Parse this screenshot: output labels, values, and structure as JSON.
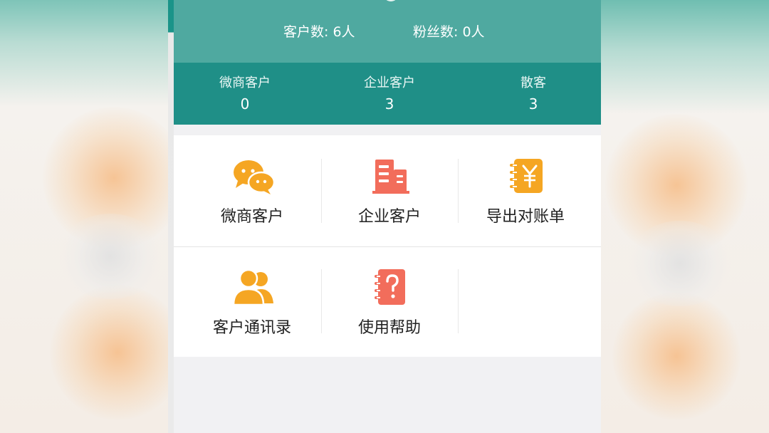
{
  "header": {
    "customer_count": "客户数: 6人",
    "fans_count": "粉丝数: 0人"
  },
  "stats": [
    {
      "label": "微商客户",
      "value": "0"
    },
    {
      "label": "企业客户",
      "value": "3"
    },
    {
      "label": "散客",
      "value": "3"
    }
  ],
  "menu": [
    {
      "label": "微商客户",
      "icon": "wechat-chat-icon",
      "color": "#f5a623"
    },
    {
      "label": "企业客户",
      "icon": "building-icon",
      "color": "#f26d5b"
    },
    {
      "label": "导出对账单",
      "icon": "bill-yuan-icon",
      "color": "#f5a623"
    },
    {
      "label": "客户通讯录",
      "icon": "contacts-people-icon",
      "color": "#f5a623"
    },
    {
      "label": "使用帮助",
      "icon": "help-book-icon",
      "color": "#f26d5b"
    }
  ],
  "colors": {
    "header_light": "#4fa9a0",
    "header_dark": "#1f8f87",
    "orange": "#f5a623",
    "red": "#f26d5b"
  }
}
